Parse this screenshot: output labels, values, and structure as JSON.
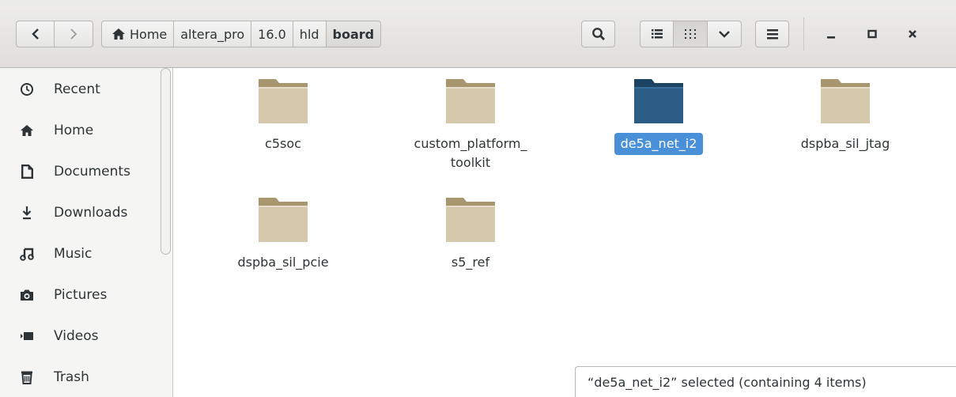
{
  "header": {
    "back_icon": "chevron-left-icon",
    "forward_icon": "chevron-right-icon",
    "breadcrumbs": [
      "Home",
      "altera_pro",
      "16.0",
      "hld",
      "board"
    ],
    "buttons": [
      "search-icon",
      "list-view-icon",
      "grid-view-icon",
      "view-options-chevron-icon",
      "menu-icon"
    ],
    "window_controls": [
      "minimize-icon",
      "maximize-icon",
      "close-icon"
    ]
  },
  "sidebar": {
    "items": [
      {
        "label": "Recent",
        "icon": "clock-icon"
      },
      {
        "label": "Home",
        "icon": "home-icon"
      },
      {
        "label": "Documents",
        "icon": "document-icon"
      },
      {
        "label": "Downloads",
        "icon": "download-icon"
      },
      {
        "label": "Music",
        "icon": "music-icon"
      },
      {
        "label": "Pictures",
        "icon": "camera-icon"
      },
      {
        "label": "Videos",
        "icon": "video-icon"
      },
      {
        "label": "Trash",
        "icon": "trash-icon"
      }
    ]
  },
  "files": [
    {
      "name": "c5soc",
      "selected": false
    },
    {
      "name": "custom_platform_\ntoolkit",
      "selected": false
    },
    {
      "name": "de5a_net_i2",
      "selected": true
    },
    {
      "name": "dspba_sil_jtag",
      "selected": false
    },
    {
      "name": "dspba_sil_pcie",
      "selected": false
    },
    {
      "name": "s5_ref",
      "selected": false
    }
  ],
  "status": "“de5a_net_i2” selected  (containing 4 items)",
  "colors": {
    "accent": "#4a90d9",
    "folder": "#d6c8ac",
    "folder_selected": "#2b5d86"
  }
}
